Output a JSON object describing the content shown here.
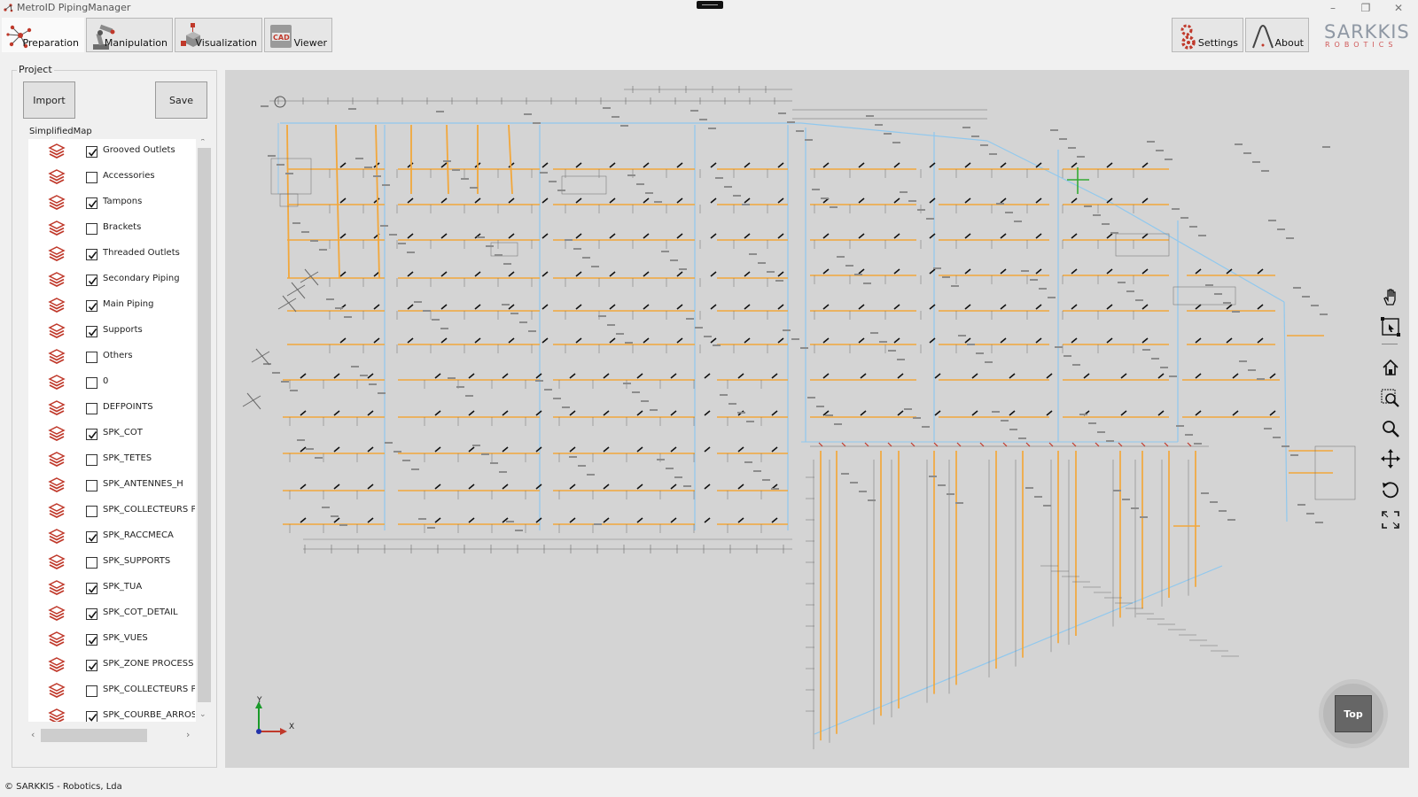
{
  "window": {
    "title": "MetroID PipingManager",
    "controls": [
      "minimize-icon",
      "restore-icon",
      "close-icon"
    ]
  },
  "toolbar": {
    "modes": [
      {
        "label": "Preparation",
        "icon": "network-icon",
        "active": true
      },
      {
        "label": "Manipulation",
        "icon": "robot-arm-icon"
      },
      {
        "label": "Visualization",
        "icon": "cubes-icon"
      },
      {
        "label": "Viewer",
        "icon": "cad-icon",
        "icon_text": "CAD"
      }
    ],
    "settings_label": "Settings",
    "about_label": "About"
  },
  "brand": {
    "line1": "SARKKIS",
    "line2": "ROBOTICS"
  },
  "project": {
    "legend": "Project",
    "import_label": "Import",
    "save_label": "Save",
    "map_label": "SimplifiedMap",
    "layers": [
      {
        "name": "Grooved Outlets",
        "checked": true
      },
      {
        "name": "Accessories",
        "checked": false
      },
      {
        "name": "Tampons",
        "checked": true
      },
      {
        "name": "Brackets",
        "checked": false
      },
      {
        "name": "Threaded Outlets",
        "checked": true
      },
      {
        "name": "Secondary Piping",
        "checked": true
      },
      {
        "name": "Main Piping",
        "checked": true
      },
      {
        "name": "Supports",
        "checked": true
      },
      {
        "name": "Others",
        "checked": false
      },
      {
        "name": "0",
        "checked": false
      },
      {
        "name": "DEFPOINTS",
        "checked": false
      },
      {
        "name": "SPK_COT",
        "checked": true
      },
      {
        "name": "SPK_TÊTES",
        "checked": false
      },
      {
        "name": "SPK_ANTENNES_H",
        "checked": false
      },
      {
        "name": "SPK_COLLECTEURS PC",
        "checked": false
      },
      {
        "name": "SPK_RACCMÉCA",
        "checked": true
      },
      {
        "name": "SPK_SUPPORTS",
        "checked": false
      },
      {
        "name": "SPK_TUA",
        "checked": true
      },
      {
        "name": "SPK_COT_DETAIL",
        "checked": true
      },
      {
        "name": "SPK_VUES",
        "checked": true
      },
      {
        "name": "SPK_ZONE PROCESS",
        "checked": true
      },
      {
        "name": "SPK_COLLECTEURS PC",
        "checked": false
      },
      {
        "name": "SPK_COURBE_ARROSA",
        "checked": true
      }
    ]
  },
  "viewport": {
    "axis_labels": {
      "y": "Y",
      "x": "X"
    },
    "view_cube_label": "Top",
    "tools": [
      "pan-hand-icon",
      "select-region-icon",
      "home-icon",
      "zoom-window-icon",
      "zoom-icon",
      "move-icon",
      "rotate-icon",
      "fit-screen-icon"
    ],
    "colors": {
      "background": "#d4d4d4",
      "main_piping": "#90c8ee",
      "secondary_piping": "#f2a73b",
      "dimension_lines": "#6a6a6a",
      "outlets": "#111111"
    }
  },
  "footer": {
    "copyright": "© SARKKIS - Robotics, Lda"
  }
}
